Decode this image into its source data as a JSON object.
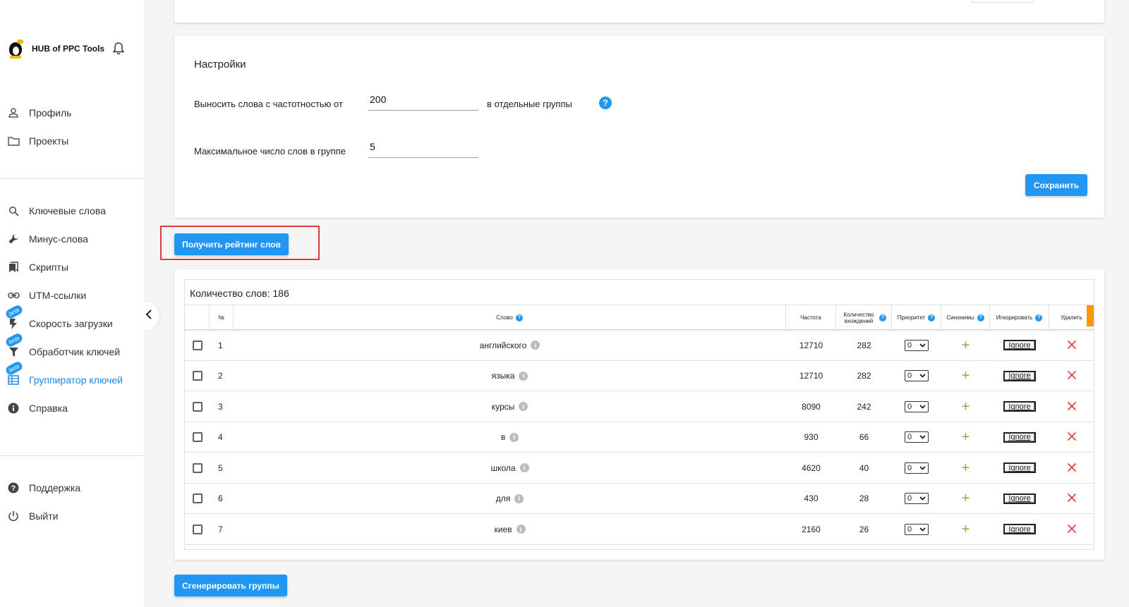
{
  "brand": {
    "name": "HUB of PPC Tools"
  },
  "sidebar": {
    "items": [
      {
        "label": "Профиль",
        "icon": "person-icon"
      },
      {
        "label": "Проекты",
        "icon": "folder-icon"
      },
      {
        "label": "Ключевые слова",
        "icon": "search-icon"
      },
      {
        "label": "Минус-слова",
        "icon": "wrench-icon"
      },
      {
        "label": "Скрипты",
        "icon": "bookmark-icon"
      },
      {
        "label": "UTM-ссылки",
        "icon": "link-icon"
      },
      {
        "label": "Скорость загрузки",
        "icon": "flash-icon",
        "badge": "beta"
      },
      {
        "label": "Обработчик ключей",
        "icon": "filter-icon",
        "badge": "beta"
      },
      {
        "label": "Группиратор ключей",
        "icon": "table-icon",
        "badge": "beta",
        "active": true
      },
      {
        "label": "Справка",
        "icon": "info-icon"
      },
      {
        "label": "Поддержка",
        "icon": "help-icon"
      },
      {
        "label": "Выйти",
        "icon": "power-icon"
      }
    ]
  },
  "settings": {
    "title": "Настройки",
    "freq_label": "Выносить слова с частотностью от",
    "freq_value": "200",
    "freq_suffix": "в отдельные группы",
    "max_label": "Максимальное число слов в группе",
    "max_value": "5",
    "save_label": "Сохранить"
  },
  "rating_button": "Получить рейтинг слов",
  "generate_button": "Сгенерировать группы",
  "table": {
    "count_label": "Количество слов: 186",
    "headers": {
      "num": "№",
      "word": "Слово",
      "freq": "Частота",
      "occurrences": "Количество вхождений",
      "priority": "Приоритет",
      "synonyms": "Синонимы",
      "ignore": "Игнорировать",
      "delete": "Удалить"
    },
    "ignore_label": "Ignore",
    "rows": [
      {
        "n": "1",
        "word": "английского",
        "freq": "12710",
        "occ": "282",
        "priority": "0"
      },
      {
        "n": "2",
        "word": "языка",
        "freq": "12710",
        "occ": "282",
        "priority": "0"
      },
      {
        "n": "3",
        "word": "курсы",
        "freq": "8090",
        "occ": "242",
        "priority": "0"
      },
      {
        "n": "4",
        "word": "в",
        "freq": "930",
        "occ": "66",
        "priority": "0"
      },
      {
        "n": "5",
        "word": "школа",
        "freq": "4620",
        "occ": "40",
        "priority": "0"
      },
      {
        "n": "6",
        "word": "для",
        "freq": "430",
        "occ": "28",
        "priority": "0"
      },
      {
        "n": "7",
        "word": "киев",
        "freq": "2160",
        "occ": "26",
        "priority": "0"
      }
    ]
  },
  "colors": {
    "accent": "#2196f3",
    "highlight": "#e53935",
    "plus": "#7cb342",
    "scroll": "#ff9800"
  }
}
